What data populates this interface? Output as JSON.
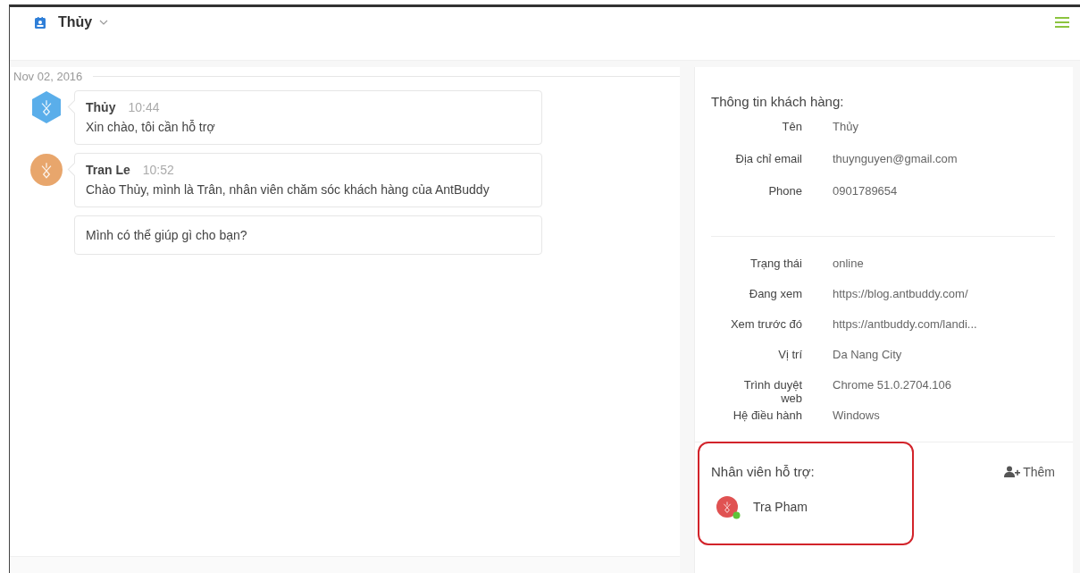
{
  "header": {
    "contact_name": "Thủy"
  },
  "chat": {
    "date": "Nov 02, 2016",
    "messages": [
      {
        "kind": "hexagon",
        "color": "#5aaeea",
        "sender": "Thủy",
        "time": "10:44",
        "text": "Xin chào, tôi cần hỗ trợ"
      },
      {
        "kind": "circle",
        "color": "#e8a66c",
        "sender": "Tran Le",
        "time": "10:52",
        "text": "Chào Thủy, mình là Trân, nhân viên chăm sóc khách hàng của AntBuddy"
      },
      {
        "kind": "plain",
        "text": "Mình có thể giúp gì cho bạn?"
      }
    ]
  },
  "customer_info": {
    "title": "Thông tin khách hàng:",
    "contact_fields": [
      {
        "label": "Tên",
        "value": "Thủy"
      },
      {
        "label": "Địa chỉ email",
        "value": "thuynguyen@gmail.com"
      },
      {
        "label": "Phone",
        "value": "0901789654"
      }
    ],
    "session_fields": [
      {
        "label": "Trạng thái",
        "value": "online"
      },
      {
        "label": "Đang xem",
        "value": "https://blog.antbuddy.com/"
      },
      {
        "label": "Xem trước đó",
        "value": "https://antbuddy.com/landi..."
      },
      {
        "label": "Vị trí",
        "value": "Da Nang City"
      },
      {
        "label": "Trình duyệt web",
        "value": "Chrome 51.0.2704.106"
      },
      {
        "label": "Hệ điều hành",
        "value": "Windows"
      }
    ]
  },
  "support_staff": {
    "title": "Nhân viên hỗ trợ:",
    "add_label": "Thêm",
    "highlighted": true,
    "members": [
      {
        "name": "Tra Pham",
        "online": true
      }
    ]
  }
}
